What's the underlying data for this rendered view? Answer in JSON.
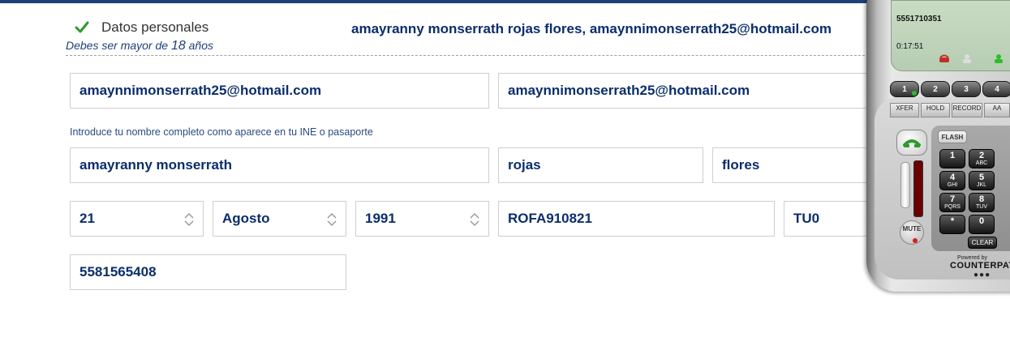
{
  "section": {
    "title": "Datos personales",
    "age_note_prefix": "Debes ser mayor de",
    "age_note_number": "18",
    "age_note_suffix": "años",
    "summary": "amayranny monserrath rojas flores, amaynnimonserrath25@hotmail.com"
  },
  "form": {
    "email": "amaynnimonserrath25@hotmail.com",
    "email_confirm": "amaynnimonserrath25@hotmail.com",
    "name_help": "Introduce tu nombre completo como aparece en tu INE o pasaporte",
    "first_name": "amayranny monserrath",
    "last_name_1": "rojas",
    "last_name_2": "flores",
    "birth_day": "21",
    "birth_month": "Agosto",
    "birth_year": "1991",
    "rfc": "ROFA910821",
    "homoclave": "TU0",
    "phone": "5581565408"
  },
  "softphone": {
    "number": "5551710351",
    "timer": "0:17:51",
    "line_buttons": [
      "1",
      "2",
      "3",
      "4"
    ],
    "function_buttons": [
      "XFER",
      "HOLD",
      "RECORD",
      "AA"
    ],
    "flash_label": "FLASH",
    "mute_label": "MUTE",
    "clear_label": "CLEAR",
    "keys": [
      {
        "digit": "1",
        "letters": ""
      },
      {
        "digit": "2",
        "letters": "ABC"
      },
      {
        "digit": "4",
        "letters": "GHI"
      },
      {
        "digit": "5",
        "letters": "JKL"
      },
      {
        "digit": "7",
        "letters": "PQRS"
      },
      {
        "digit": "8",
        "letters": "TUV"
      },
      {
        "digit": "*",
        "letters": ""
      },
      {
        "digit": "0",
        "letters": ""
      }
    ],
    "powered_by": "Powered by",
    "brand": "COUNTERPATH",
    "accent_green": "#2bbd2b",
    "accent_red": "#d8201b"
  },
  "colors": {
    "top_bar": "#1f3f7a",
    "text_primary": "#0b2d6b",
    "check_green": "#2e9a2e"
  }
}
